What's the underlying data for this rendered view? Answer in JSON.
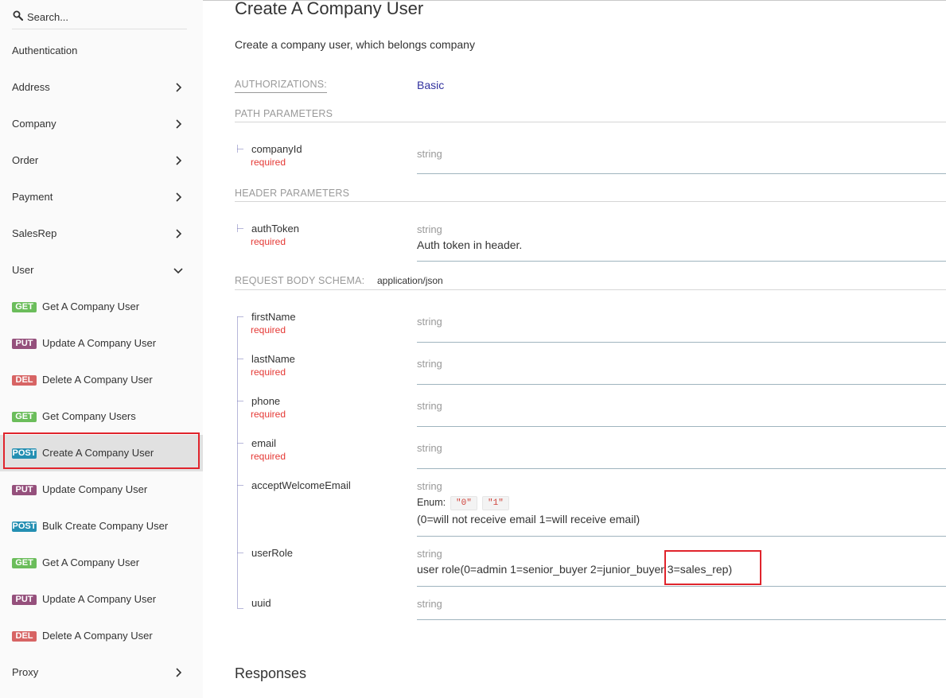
{
  "sidebar": {
    "search_placeholder": "Search...",
    "items": [
      {
        "label": "Authentication"
      },
      {
        "label": "Address"
      },
      {
        "label": "Company"
      },
      {
        "label": "Order"
      },
      {
        "label": "Payment"
      },
      {
        "label": "SalesRep"
      },
      {
        "label": "User"
      }
    ],
    "operations": [
      {
        "method": "GET",
        "label": "Get A Company User"
      },
      {
        "method": "PUT",
        "label": "Update A Company User"
      },
      {
        "method": "DEL",
        "label": "Delete A Company User"
      },
      {
        "method": "GET",
        "label": "Get Company Users"
      },
      {
        "method": "POST",
        "label": "Create A Company User"
      },
      {
        "method": "PUT",
        "label": "Update Company User"
      },
      {
        "method": "POST",
        "label": "Bulk Create Company User"
      },
      {
        "method": "GET",
        "label": "Get A Company User"
      },
      {
        "method": "PUT",
        "label": "Update A Company User"
      },
      {
        "method": "DEL",
        "label": "Delete A Company User"
      }
    ],
    "proxy_label": "Proxy"
  },
  "main": {
    "title": "Create A Company User",
    "description": "Create a company user, which belongs company",
    "auth_label": "AUTHORIZATIONS:",
    "auth_value": "Basic",
    "path_params_title": "PATH PARAMETERS",
    "header_params_title": "HEADER PARAMETERS",
    "body_schema_title": "REQUEST BODY SCHEMA:",
    "body_media_type": "application/json",
    "required_label": "required",
    "path_params": [
      {
        "name": "companyId",
        "type": "string"
      }
    ],
    "header_params": [
      {
        "name": "authToken",
        "type": "string",
        "description": "Auth token in header."
      }
    ],
    "body_params": [
      {
        "name": "firstName",
        "type": "string"
      },
      {
        "name": "lastName",
        "type": "string"
      },
      {
        "name": "phone",
        "type": "string"
      },
      {
        "name": "email",
        "type": "string"
      },
      {
        "name": "acceptWelcomeEmail",
        "type": "string",
        "enum_label": "Enum:",
        "enum_values": [
          "\"0\"",
          "\"1\""
        ],
        "description": "(0=will not receive email 1=will receive email)"
      },
      {
        "name": "userRole",
        "type": "string",
        "description": "user role(0=admin 1=senior_buyer 2=junior_buyer 3=sales_rep)"
      },
      {
        "name": "uuid",
        "type": "string"
      }
    ],
    "responses_title": "Responses"
  },
  "colors": {
    "get": "#6bbd5b",
    "put": "#95507c",
    "delete": "#cc3333",
    "post": "#248fb2",
    "required": "#e53935",
    "auth_link": "#32329f",
    "annotation": "#e0242c"
  }
}
